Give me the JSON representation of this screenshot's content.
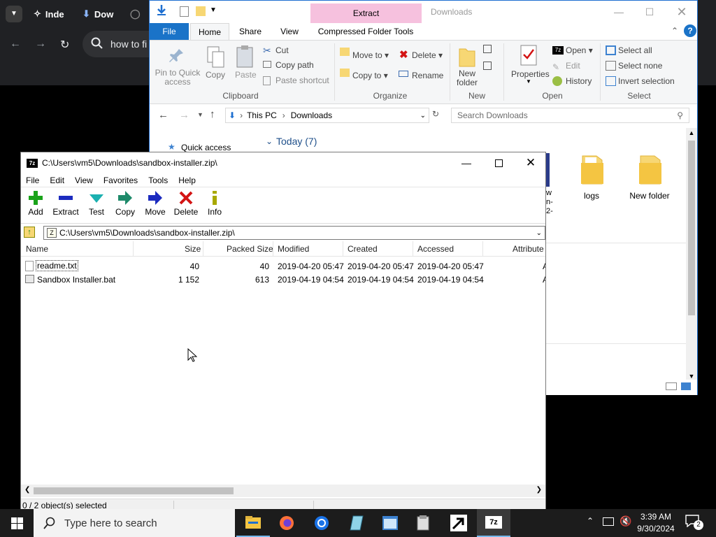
{
  "browser": {
    "tabs": [
      "Inde",
      "Dow"
    ],
    "address": "how to fi"
  },
  "explorer": {
    "context_tab": "Extract",
    "title": "Downloads",
    "tabs": [
      "File",
      "Home",
      "Share",
      "View",
      "Compressed Folder Tools"
    ],
    "clipboard": {
      "pin": "Pin to Quick access",
      "copy": "Copy",
      "paste": "Paste",
      "cut": "Cut",
      "copy_path": "Copy path",
      "paste_shortcut": "Paste shortcut",
      "group": "Clipboard"
    },
    "organize": {
      "move_to": "Move to",
      "copy_to": "Copy to",
      "delete": "Delete",
      "rename": "Rename",
      "group": "Organize"
    },
    "new": {
      "new_folder": "New folder",
      "group": "New"
    },
    "open": {
      "properties": "Properties",
      "open": "Open",
      "edit": "Edit",
      "history": "History",
      "group": "Open"
    },
    "select": {
      "select_all": "Select all",
      "select_none": "Select none",
      "invert": "Invert selection",
      "group": "Select"
    },
    "path": [
      "This PC",
      "Downloads"
    ],
    "search_placeholder": "Search Downloads",
    "quick_access": "Quick access",
    "group_header": "Today (7)",
    "folders": [
      "logs",
      "New folder"
    ],
    "partial_item_text": [
      "w",
      "n-",
      "2-"
    ]
  },
  "sevenzip": {
    "title": "C:\\Users\\vm5\\Downloads\\sandbox-installer.zip\\",
    "menu": [
      "File",
      "Edit",
      "View",
      "Favorites",
      "Tools",
      "Help"
    ],
    "toolbar": [
      "Add",
      "Extract",
      "Test",
      "Copy",
      "Move",
      "Delete",
      "Info"
    ],
    "address": "C:\\Users\\vm5\\Downloads\\sandbox-installer.zip\\",
    "columns": [
      "Name",
      "Size",
      "Packed Size",
      "Modified",
      "Created",
      "Accessed",
      "Attribute"
    ],
    "rows": [
      {
        "name": "readme.txt",
        "size": "40",
        "packed": "40",
        "modified": "2019-04-20 05:47",
        "created": "2019-04-20 05:47",
        "accessed": "2019-04-20 05:47",
        "attr": "A"
      },
      {
        "name": "Sandbox Installer.bat",
        "size": "1 152",
        "packed": "613",
        "modified": "2019-04-19 04:54",
        "created": "2019-04-19 04:54",
        "accessed": "2019-04-19 04:54",
        "attr": "A"
      }
    ],
    "status": "0 / 2 object(s) selected",
    "colors": {
      "add": "#1aa31a",
      "extract": "#1c2bbf",
      "test": "#1bb0b0",
      "delete": "#d31414"
    }
  },
  "taskbar": {
    "search_placeholder": "Type here to search",
    "time": "3:39 AM",
    "date": "9/30/2024",
    "notifications": "2"
  }
}
